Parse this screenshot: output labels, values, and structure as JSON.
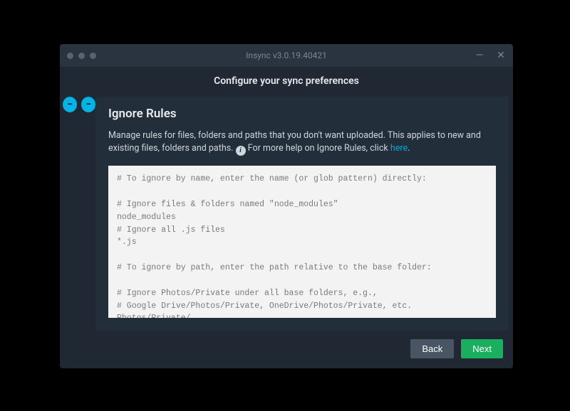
{
  "window": {
    "title": "Insync v3.0.19.40421"
  },
  "header": {
    "subtitle": "Configure your sync preferences"
  },
  "panel": {
    "title": "Ignore Rules",
    "description_part1": "Manage rules for files, folders and paths that you don't want uploaded. This applies to new and existing files, folders and paths. ",
    "description_part2": " For more help on Ignore Rules, click ",
    "help_link_label": "here",
    "description_end": "."
  },
  "editor": {
    "content": "# To ignore by name, enter the name (or glob pattern) directly:\n\n# Ignore files & folders named \"node_modules\"\nnode_modules\n# Ignore all .js files\n*.js\n\n# To ignore by path, enter the path relative to the base folder:\n\n# Ignore Photos/Private under all base folders, e.g.,\n# Google Drive/Photos/Private, OneDrive/Photos/Private, etc.\nPhotos/Private/"
  },
  "footer": {
    "back_label": "Back",
    "next_label": "Next"
  },
  "tabs": {
    "minus_symbol": "−"
  }
}
